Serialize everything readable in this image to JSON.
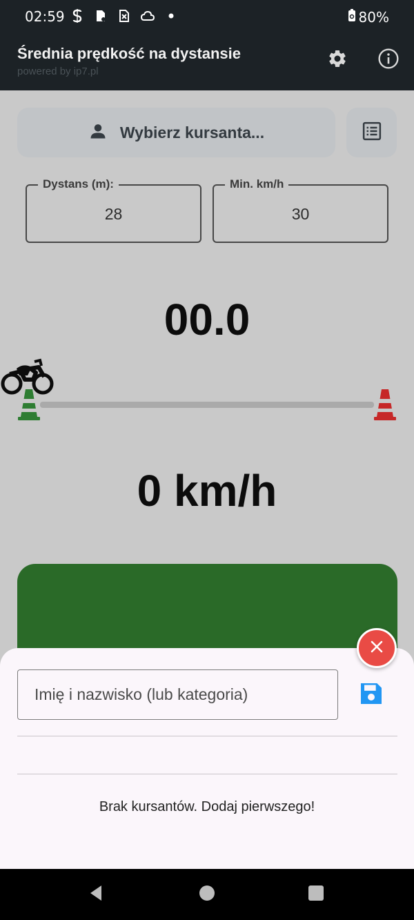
{
  "status_bar": {
    "time": "02:59",
    "battery": "80%",
    "icons": [
      "s-icon",
      "sim-card-icon",
      "sim-blocked-icon",
      "cloud-icon",
      "dot-icon"
    ]
  },
  "app_bar": {
    "title": "Średnia prędkość na dystansie",
    "subtitle": "powered by ip7.pl",
    "icons": [
      "gear-icon",
      "info-icon"
    ]
  },
  "main": {
    "select_student_label": "Wybierz kursanta...",
    "distance": {
      "label": "Dystans (m):",
      "value": "28"
    },
    "min_speed": {
      "label": "Min. km/h",
      "value": "30"
    },
    "timer": "00.0",
    "speed": "0 km/h",
    "colors": {
      "start_button": "#2a6a28",
      "cone_start": "#2e7d32",
      "cone_finish": "#c62828"
    }
  },
  "sheet": {
    "name_placeholder": "Imię i nazwisko (lub kategoria)",
    "empty_message": "Brak kursantów. Dodaj pierwszego!",
    "colors": {
      "save_icon": "#2196f3",
      "close_button": "#e94b45"
    }
  }
}
